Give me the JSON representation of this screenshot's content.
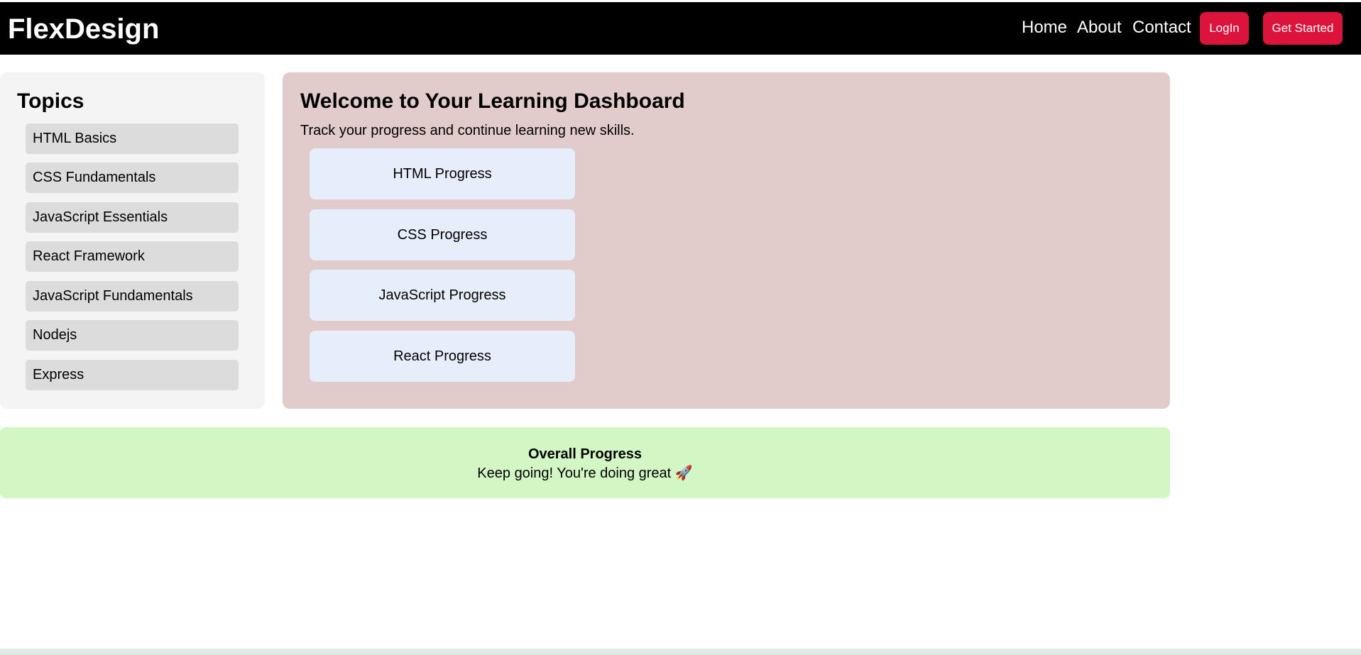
{
  "header": {
    "logo": "FlexDesign",
    "nav": {
      "home": "Home",
      "about": "About",
      "contact": "Contact"
    },
    "login_label": "LogIn",
    "get_started_label": "Get Started"
  },
  "sidebar": {
    "title": "Topics",
    "items": [
      {
        "label": "HTML Basics"
      },
      {
        "label": "CSS Fundamentals"
      },
      {
        "label": "JavaScript Essentials"
      },
      {
        "label": "React Framework"
      },
      {
        "label": "JavaScript Fundamentals"
      },
      {
        "label": "Nodejs"
      },
      {
        "label": "Express"
      }
    ]
  },
  "main": {
    "title": "Welcome to Your Learning Dashboard",
    "subtitle": "Track your progress and continue learning new skills.",
    "progress_cards": [
      {
        "label": "HTML Progress"
      },
      {
        "label": "CSS Progress"
      },
      {
        "label": "JavaScript Progress"
      },
      {
        "label": "React Progress"
      }
    ]
  },
  "overall": {
    "title": "Overall Progress",
    "message": "Keep going! You're doing great 🚀"
  },
  "colors": {
    "header_bg": "#000000",
    "accent_button": "#dc143c",
    "sidebar_bg": "#f4f4f4",
    "topic_item_bg": "#dcdcdc",
    "main_panel_bg": "#e2cbcb",
    "progress_card_bg": "#e7eefb",
    "overall_bg": "#d2f7c5"
  }
}
